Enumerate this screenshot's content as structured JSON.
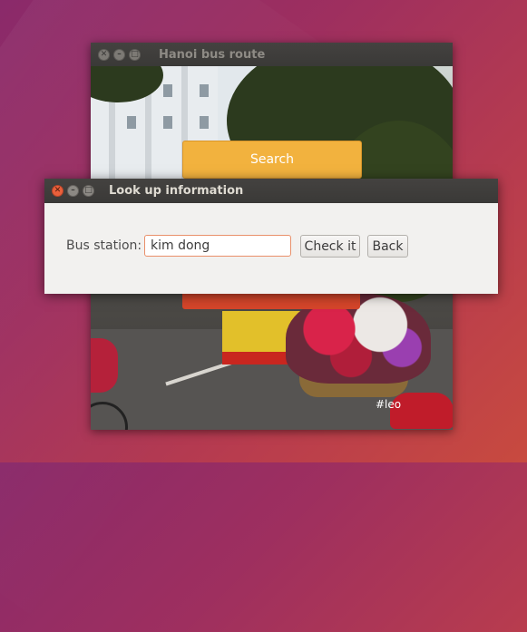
{
  "main_window": {
    "title": "Hanoi bus route",
    "search_label": "Search",
    "watermark": "#leo"
  },
  "dialog": {
    "title": "Look up information",
    "field_label": "Bus station:",
    "field_value": "kim dong",
    "check_label": "Check it",
    "back_label": "Back"
  },
  "colors": {
    "search_button": "#f2b23e",
    "close_button": "#e9603b",
    "titlebar": "#3a3937",
    "dialog_bg": "#f2f1ef"
  }
}
